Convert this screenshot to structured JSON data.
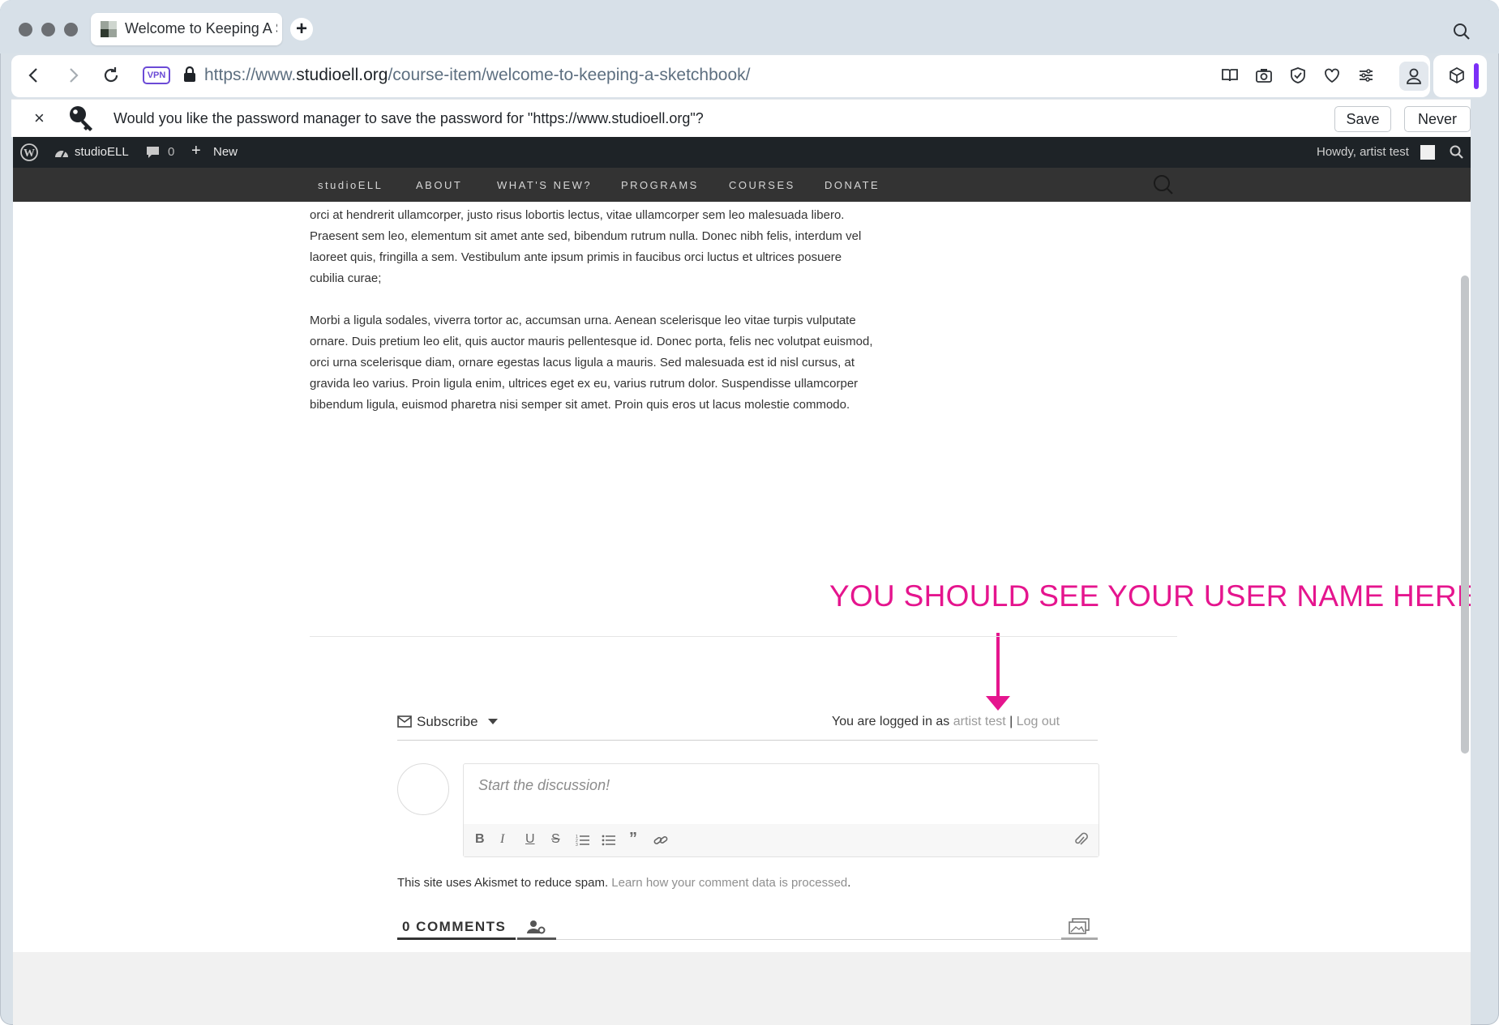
{
  "browser": {
    "tab_title": "Welcome to Keeping A S",
    "new_tab_symbol": "+",
    "url_prefix": "https://www.",
    "url_domain": "studioell.org",
    "url_path": "/course-item/welcome-to-keeping-a-sketchbook/",
    "vpn_label": "VPN",
    "accent_color": "#7b2ff7"
  },
  "password_bar": {
    "message": "Would you like the password manager to save the password for \"https://www.studioell.org\"?",
    "save_label": "Save",
    "never_label": "Never",
    "close_symbol": "×"
  },
  "admin_bar": {
    "site_name": "studioELL",
    "comments_count": "0",
    "new_label": "New",
    "greeting": "Howdy, artist test"
  },
  "site_nav": {
    "items": [
      "studioELL",
      "ABOUT",
      "WHAT'S NEW?",
      "PROGRAMS",
      "COURSES",
      "DONATE"
    ]
  },
  "content": {
    "paragraph1": "orci at hendrerit ullamcorper, justo risus lobortis lectus, vitae ullamcorper sem leo malesuada libero. Praesent sem leo, elementum sit amet ante sed, bibendum rutrum nulla. Donec nibh felis, interdum vel laoreet quis, fringilla a sem. Vestibulum ante ipsum primis in faucibus orci luctus et ultrices posuere cubilia curae;",
    "paragraph2": "Morbi a ligula sodales, viverra tortor ac, accumsan urna. Aenean scelerisque leo vitae turpis vulputate ornare. Duis pretium leo elit, quis auctor mauris pellentesque id. Donec porta, felis nec volutpat euismod, orci urna scelerisque diam, ornare egestas lacus ligula a mauris. Sed malesuada est id nisl cursus, at gravida leo varius. Proin ligula enim, ultrices eget ex eu, varius rutrum dolor. Suspendisse ullamcorper bibendum ligula, euismod pharetra nisi semper sit amet. Proin quis eros ut lacus molestie commodo."
  },
  "annotation": {
    "text": "YOU SHOULD SEE YOUR USER NAME HERE",
    "color": "#e5158e"
  },
  "comments": {
    "subscribe_label": "Subscribe",
    "logged_in_prefix": "You are logged in as",
    "username": "artist test",
    "separator": "|",
    "logout_label": "Log out",
    "placeholder": "Start the discussion!",
    "akismet_text": "This site uses Akismet to reduce spam.",
    "akismet_link": "Learn how your comment data is processed",
    "akismet_suffix": ".",
    "count_label": "0 COMMENTS"
  }
}
